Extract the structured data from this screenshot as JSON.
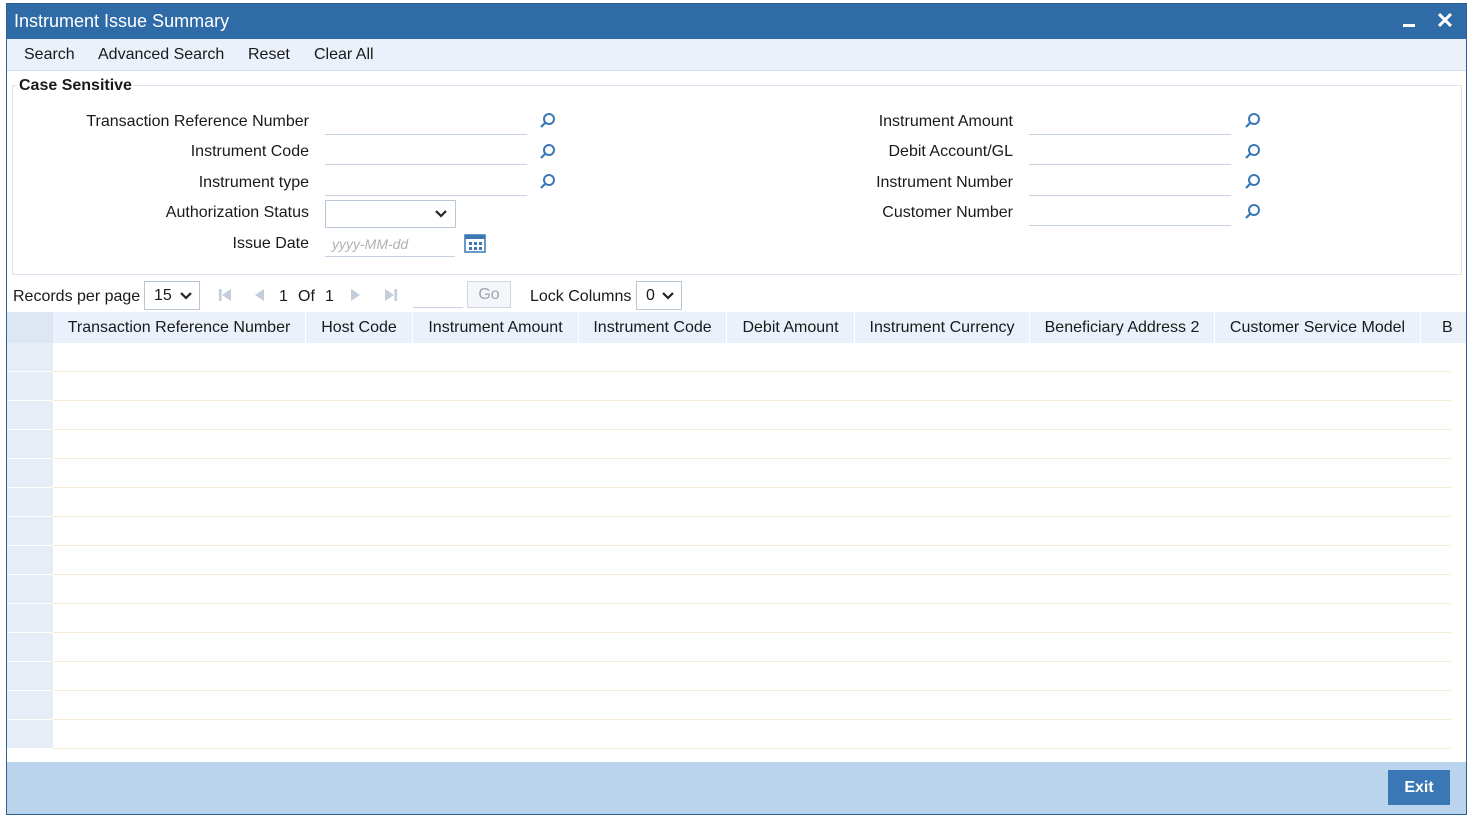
{
  "window": {
    "title": "Instrument Issue Summary"
  },
  "toolbar": {
    "search": "Search",
    "advanced_search": "Advanced Search",
    "reset": "Reset",
    "clear_all": "Clear All"
  },
  "criteria": {
    "legend": "Case Sensitive",
    "left": [
      {
        "label": "Transaction Reference Number",
        "value": ""
      },
      {
        "label": "Instrument Code",
        "value": ""
      },
      {
        "label": "Instrument type",
        "value": ""
      },
      {
        "label": "Authorization Status",
        "value": ""
      },
      {
        "label": "Issue Date",
        "placeholder": "yyyy-MM-dd"
      }
    ],
    "right": [
      {
        "label": "Instrument Amount",
        "value": ""
      },
      {
        "label": "Debit Account/GL",
        "value": ""
      },
      {
        "label": "Instrument Number",
        "value": ""
      },
      {
        "label": "Customer Number",
        "value": ""
      }
    ]
  },
  "pager": {
    "records_label": "Records per page",
    "records_value": "15",
    "current_page": "1",
    "of_label": "Of",
    "total_pages": "1",
    "go_label": "Go",
    "lock_label": "Lock Columns",
    "lock_value": "0"
  },
  "grid": {
    "columns": [
      "Transaction Reference Number",
      "Host Code",
      "Instrument Amount",
      "Instrument Code",
      "Debit Amount",
      "Instrument Currency",
      "Beneficiary Address 2",
      "Customer Service Model",
      "B"
    ],
    "rows": []
  },
  "footer": {
    "exit_label": "Exit"
  },
  "icons": {
    "lookup": "search-icon",
    "calendar": "calendar-icon"
  },
  "colors": {
    "titlebar": "#2f6ba6",
    "footer": "#b9d4ec",
    "accent": "#3a78b5"
  }
}
